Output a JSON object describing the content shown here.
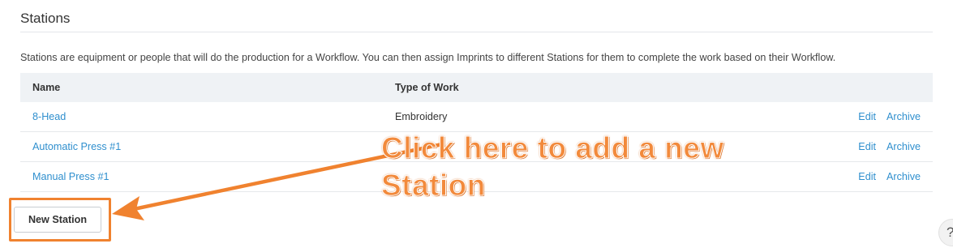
{
  "page": {
    "title": "Stations",
    "description": "Stations are equipment or people that will do the production for a Workflow. You can then assign Imprints to different Stations for them to complete the work based on their Workflow."
  },
  "table": {
    "headers": {
      "name": "Name",
      "type": "Type of Work"
    },
    "rows": [
      {
        "name": "8-Head",
        "type": "Embroidery",
        "edit": "Edit",
        "archive": "Archive"
      },
      {
        "name": "Automatic Press #1",
        "type": "",
        "edit": "Edit",
        "archive": "Archive"
      },
      {
        "name": "Manual Press #1",
        "type": "",
        "edit": "Edit",
        "archive": "Archive"
      }
    ]
  },
  "actions": {
    "new_station": "New Station"
  },
  "callout": {
    "text": "Click here to add a new Station",
    "color": "#f0822f"
  },
  "help": {
    "icon": "help-icon",
    "glyph": "?"
  },
  "colors": {
    "link": "#2f8fce",
    "header_bg": "#eff2f5"
  }
}
